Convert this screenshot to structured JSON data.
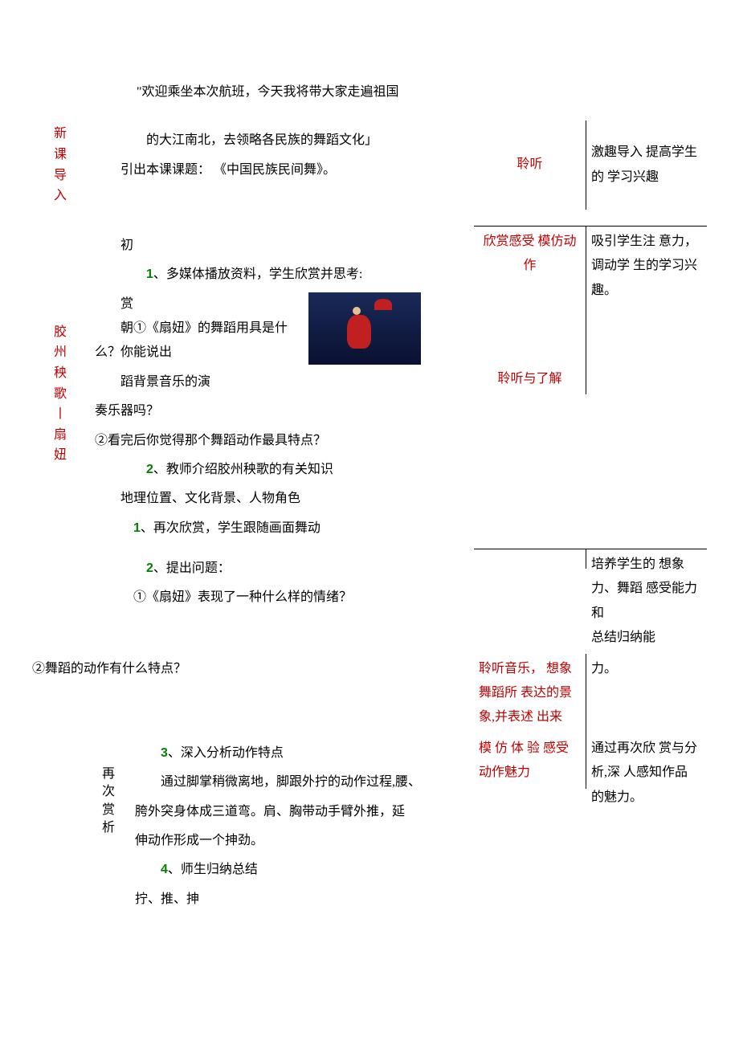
{
  "intro_quote": "\"欢迎乘坐本次航班，今天我将带大家走遍祖国",
  "section1": {
    "label_chars": [
      "新",
      "课",
      "导",
      "入"
    ],
    "line1": "的大江南北，去领略各民族的舞蹈文化」",
    "line2_a": "引出本课课题：",
    "line2_b": "《中国民族民间舞》。",
    "student": "聆听",
    "intent": "激趣导入 提高学生的 学习兴趣"
  },
  "section2": {
    "label_chars": [
      "胶",
      "州",
      "秧",
      "歌",
      "丨",
      "扇",
      "妞"
    ],
    "sub_label_a": "初",
    "sub_label_b": "赏",
    "p1_num": "1",
    "p1_text": "、多媒体播放资料，学生欣赏并思考:",
    "p2": "朝①《扇妞》的舞蹈用具是什么？你能说出",
    "p3a": "蹈背景音乐的演",
    "p3b": "奏乐器吗？",
    "p4": "②看完后你觉得那个舞蹈动作最具特点？",
    "p5_num": "2",
    "p5_text": "、教师介绍胶州秧歌的有关知识",
    "p6": "地理位置、文化背景、人物角色",
    "p7_num": "1",
    "p7_text": "、再次欣赏，学生跟随画面舞动",
    "student_a": "欣赏感受 模仿动作",
    "student_b": "聆听与了解",
    "intent_a": "吸引学生注 意力，调动学 生的学习兴 趣。"
  },
  "section3": {
    "p1_num": "2",
    "p1_text": "、提出问题：",
    "p2": "①《扇妞》表现了一种什么样的情绪？",
    "p3": "②舞蹈的动作有什么特点？",
    "sub_label": "再次赏析",
    "p4_num": "3",
    "p4_text": "、深入分析动作特点",
    "p5": "通过脚掌稍微离地，脚跟外拧的动作过程,腰、",
    "p6": "胯外突身体成三道弯。肩、胸带动手臂外推，延",
    "p7": "伸动作形成一个抻劲。",
    "p8_num": "4",
    "p8_text": "、师生归纳总结",
    "p9": "拧、推、抻",
    "student_a": "聆听音乐， 想象舞蹈所 表达的景 象,并表述 出来",
    "student_b": "模 仿 体 验 感受动作魅力",
    "intent_a": "培养学生的 想象力、舞蹈 感受能力和",
    "intent_a2": "总结归纳能",
    "intent_a3": "力。",
    "intent_b": "通过再次欣 赏与分析,深 人感知作品 的魅力。"
  }
}
